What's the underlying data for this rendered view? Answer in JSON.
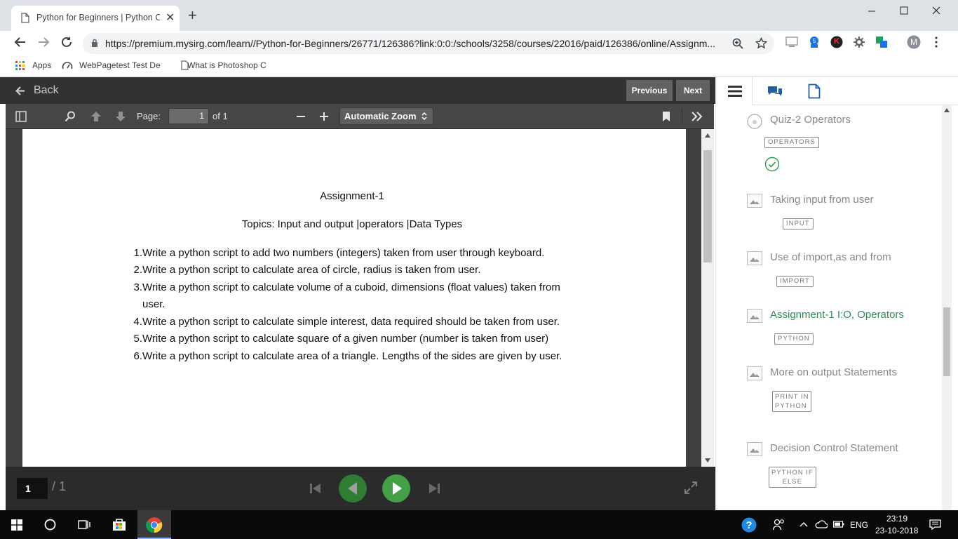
{
  "browser": {
    "tab_title": "Python for Beginners | Python Co",
    "url": "https://premium.mysirg.com/learn//Python-for-Beginners/26771/126386?link:0:0:/schools/3258/courses/22016/paid/126386/online/Assignm...",
    "bookmarks": [
      "Apps",
      "WebPagetest Test De",
      "What is Photoshop C"
    ],
    "profile_initial": "M",
    "ext_k_initial": "K"
  },
  "lms": {
    "back_label": "Back",
    "prev_label": "Previous",
    "next_label": "Next"
  },
  "pdf_toolbar": {
    "page_label": "Page:",
    "page_value": "1",
    "page_of": "of 1",
    "zoom": "Automatic Zoom"
  },
  "document": {
    "title": "Assignment-1",
    "topics": "Topics: Input and output |operators |Data Types",
    "questions": [
      {
        "n": "1.",
        "text": "Write a python script to add two numbers (integers) taken from user through keyboard."
      },
      {
        "n": "2.",
        "text": "Write a python script to calculate area of circle, radius is taken from user."
      },
      {
        "n": "3.",
        "text": "Write a python script to calculate volume of a cuboid, dimensions (float values) taken from"
      },
      {
        "n": "",
        "text": "user."
      },
      {
        "n": "4.",
        "text": "Write a python script to calculate simple interest, data required should be taken from user."
      },
      {
        "n": "5.",
        "text": "Write a python script to calculate square of a given number (number is taken from user)"
      },
      {
        "n": "6.",
        "text": "Write a python script to calculate area of a triangle. Lengths of the sides are given by user."
      }
    ]
  },
  "bottom": {
    "page_current": "1",
    "page_total": "/ 1"
  },
  "sidebar": {
    "items": [
      {
        "title": "Quiz-2 Operators",
        "tags": [
          "OPERATORS"
        ],
        "icon": "quiz-icon",
        "completed": true,
        "active": false
      },
      {
        "title": "Taking input from user",
        "tags": [
          "INPUT"
        ],
        "icon": "image-icon",
        "completed": false,
        "active": false
      },
      {
        "title": "Use of import,as and from",
        "tags": [
          "IMPORT"
        ],
        "icon": "image-icon",
        "completed": false,
        "active": false
      },
      {
        "title": "Assignment-1 I:O, Operators",
        "tags": [
          "PYTHON"
        ],
        "icon": "image-icon",
        "completed": false,
        "active": true
      },
      {
        "title": "More on output Statements",
        "tags": [
          "PRINT IN",
          "PYTHON"
        ],
        "icon": "image-icon",
        "completed": false,
        "active": false
      },
      {
        "title": "Decision Control Statement",
        "tags": [
          "PYTHON IF",
          "ELSE"
        ],
        "icon": "image-icon",
        "completed": false,
        "active": false
      }
    ],
    "active_color": "#2e8b57"
  },
  "taskbar": {
    "language": "ENG",
    "time": "23:19",
    "date": "23-10-2018"
  }
}
